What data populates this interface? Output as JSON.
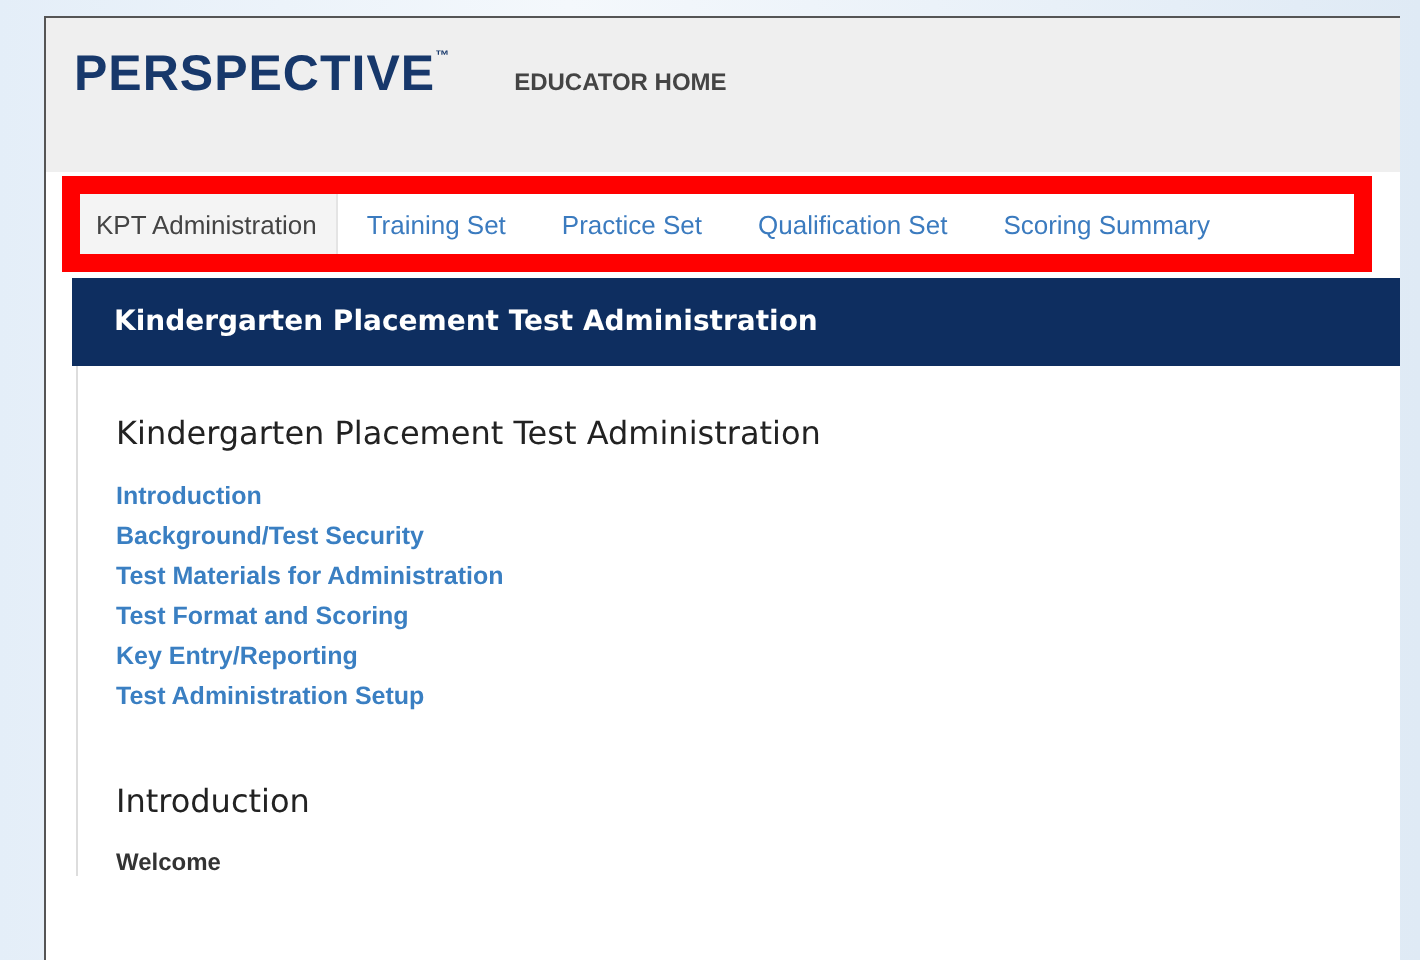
{
  "header": {
    "logo": "PERSPECTIVE",
    "trademark": "™",
    "nav_link": "EDUCATOR HOME"
  },
  "tabs": [
    {
      "label": "KPT Administration",
      "selected": true
    },
    {
      "label": "Training Set",
      "selected": false
    },
    {
      "label": "Practice Set",
      "selected": false
    },
    {
      "label": "Qualification Set",
      "selected": false
    },
    {
      "label": "Scoring Summary",
      "selected": false
    }
  ],
  "panel": {
    "title": "Kindergarten Placement Test Administration",
    "heading": "Kindergarten Placement Test Administration",
    "links": [
      "Introduction",
      "Background/Test Security",
      "Test Materials for Administration",
      "Test Format and Scoring",
      "Key Entry/Reporting",
      "Test Administration Setup"
    ],
    "section_heading": "Introduction",
    "subheading": "Welcome"
  }
}
